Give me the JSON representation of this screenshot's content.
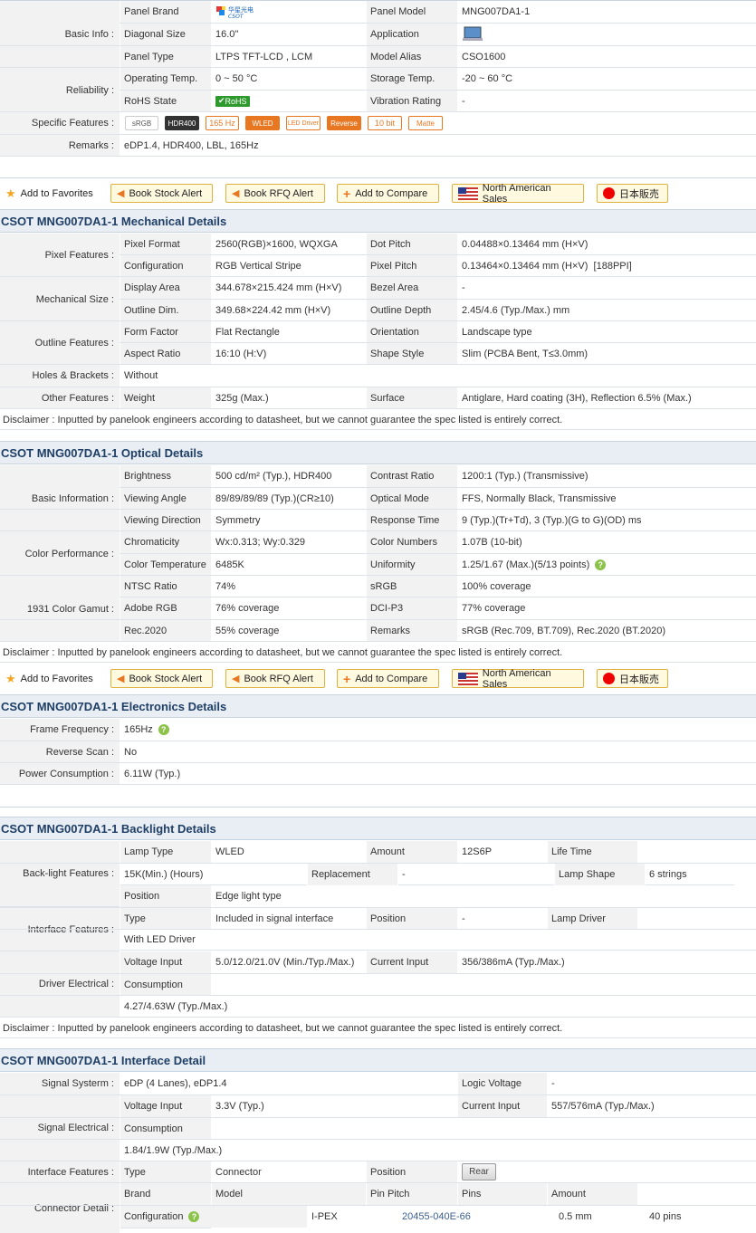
{
  "basic": {
    "label_basic": "Basic Info :",
    "label_reliability": "Reliability :",
    "panel_brand_key": "Panel Brand",
    "brand_logo_text": "CSOT",
    "panel_model_key": "Panel Model",
    "panel_model": "MNG007DA1-1",
    "diagonal_key": "Diagonal Size",
    "diagonal": "16.0\"",
    "application_key": "Application",
    "application_icon": "laptop-icon",
    "panel_type_key": "Panel Type",
    "panel_type": "LTPS TFT-LCD , LCM",
    "model_alias_key": "Model Alias",
    "model_alias": "CSO1600",
    "op_temp_key": "Operating Temp.",
    "op_temp": "0 ~ 50 °C",
    "storage_temp_key": "Storage Temp.",
    "storage_temp": "-20 ~ 60 °C",
    "rohs_key": "RoHS State",
    "rohs_badge": "RoHS",
    "vibration_key": "Vibration Rating",
    "vibration": "-",
    "specific_features_label": "Specific Features :",
    "feature_badges": [
      "sRGB",
      "HDR400",
      "165 Hz",
      "WLED",
      "LED Driver",
      "Reverse",
      "10 bit",
      "Matte"
    ],
    "remarks_label": "Remarks :",
    "remarks": "eDP1.4, HDR400, LBL, 165Hz"
  },
  "buttons": {
    "favorites": "Add to Favorites",
    "stock_alert": "Book Stock Alert",
    "rfq_alert": "Book RFQ Alert",
    "compare": "Add to Compare",
    "na_sales": "North American Sales",
    "jp_sales": "日本販売"
  },
  "mechanical": {
    "title": "CSOT MNG007DA1-1 Mechanical Details",
    "pixel_features_label": "Pixel Features :",
    "pixel_format_key": "Pixel Format",
    "pixel_format": "2560(RGB)×1600, WQXGA",
    "dot_pitch_key": "Dot Pitch",
    "dot_pitch": "0.04488×0.13464 mm (H×V)",
    "configuration_key": "Configuration",
    "configuration": "RGB Vertical Stripe",
    "pixel_pitch_key": "Pixel Pitch",
    "pixel_pitch": "0.13464×0.13464 mm (H×V)  [188PPI]",
    "mech_size_label": "Mechanical Size :",
    "display_area_key": "Display Area",
    "display_area": "344.678×215.424 mm (H×V)",
    "bezel_area_key": "Bezel Area",
    "bezel_area": "-",
    "outline_dim_key": "Outline Dim.",
    "outline_dim": "349.68×224.42 mm (H×V)",
    "outline_depth_key": "Outline Depth",
    "outline_depth": "2.45/4.6 (Typ./Max.) mm",
    "outline_features_label": "Outline Features :",
    "form_factor_key": "Form Factor",
    "form_factor": "Flat Rectangle",
    "orientation_key": "Orientation",
    "orientation": "Landscape type",
    "aspect_ratio_key": "Aspect Ratio",
    "aspect_ratio": "16:10 (H:V)",
    "shape_style_key": "Shape Style",
    "shape_style": "Slim (PCBA Bent, T≤3.0mm)",
    "holes_label": "Holes & Brackets :",
    "holes": "Without",
    "other_features_label": "Other Features :",
    "weight_key": "Weight",
    "weight": "325g (Max.)",
    "surface_key": "Surface",
    "surface": "Antiglare, Hard coating (3H), Reflection 6.5% (Max.)",
    "disclaimer": "Disclaimer : Inputted by panelook engineers according to datasheet, but we cannot guarantee the spec listed is entirely correct."
  },
  "optical": {
    "title": "CSOT MNG007DA1-1 Optical Details",
    "basic_info_label": "Basic Information :",
    "brightness_key": "Brightness",
    "brightness": "500 cd/m² (Typ.), HDR400",
    "contrast_key": "Contrast Ratio",
    "contrast": "1200:1 (Typ.) (Transmissive)",
    "viewing_angle_key": "Viewing Angle",
    "viewing_angle": "89/89/89/89 (Typ.)(CR≥10)",
    "optical_mode_key": "Optical Mode",
    "optical_mode": "FFS, Normally Black, Transmissive",
    "viewing_dir_key": "Viewing Direction",
    "viewing_dir": "Symmetry",
    "response_key": "Response Time",
    "response": "9 (Typ.)(Tr+Td), 3 (Typ.)(G to G)(OD) ms",
    "color_perf_label": "Color Performance :",
    "chromaticity_key": "Chromaticity",
    "chromaticity": "Wx:0.313; Wy:0.329",
    "color_numbers_key": "Color Numbers",
    "color_numbers": "1.07B (10-bit)",
    "color_temp_key": "Color Temperature",
    "color_temp": "6485K",
    "uniformity_key": "Uniformity",
    "uniformity": "1.25/1.67 (Max.)(5/13 points)",
    "gamut_label": "1931 Color Gamut :",
    "ntsc_key": "NTSC Ratio",
    "ntsc": "74%",
    "srgb_key": "sRGB",
    "srgb": "100% coverage",
    "adobe_key": "Adobe RGB",
    "adobe": "76% coverage",
    "dcip3_key": "DCI-P3",
    "dcip3": "77% coverage",
    "rec2020_key": "Rec.2020",
    "rec2020": "55% coverage",
    "remarks_key": "Remarks",
    "remarks": "sRGB (Rec.709, BT.709), Rec.2020 (BT.2020)",
    "disclaimer": "Disclaimer : Inputted by panelook engineers according to datasheet, but we cannot guarantee the spec listed is entirely correct."
  },
  "electronics": {
    "title": "CSOT MNG007DA1-1 Electronics Details",
    "frame_freq_label": "Frame Frequency :",
    "frame_freq": "165Hz",
    "reverse_scan_label": "Reverse Scan :",
    "reverse_scan": "No",
    "power_label": "Power Consumption :",
    "power": "6.11W (Typ.)"
  },
  "backlight": {
    "title": "CSOT MNG007DA1-1 Backlight Details",
    "features_label": "Back-light Features :",
    "lamp_type_key": "Lamp Type",
    "lamp_type": "WLED",
    "amount_key": "Amount",
    "amount": "12S6P",
    "life_time_key": "Life Time",
    "life_time": "15K(Min.) (Hours)",
    "replacement_key": "Replacement",
    "replacement": "-",
    "lamp_shape_key": "Lamp Shape",
    "lamp_shape": "6 strings",
    "position_key": "Position",
    "position": "Edge light type",
    "interface_label": "Interface Features :",
    "type_key": "Type",
    "type": "Included in signal interface",
    "position2_key": "Position",
    "position2": "-",
    "lamp_driver_key": "Lamp Driver",
    "lamp_driver": "With LED Driver",
    "driver_label": "Driver Electrical :",
    "voltage_key": "Voltage Input",
    "voltage": "5.0/12.0/21.0V (Min./Typ./Max.)",
    "current_key": "Current Input",
    "current": "356/386mA (Typ./Max.)",
    "consumption_key": "Consumption",
    "consumption": "4.27/4.63W (Typ./Max.)",
    "disclaimer": "Disclaimer : Inputted by panelook engineers according to datasheet, but we cannot guarantee the spec listed is entirely correct."
  },
  "interface": {
    "title": "CSOT MNG007DA1-1 Interface Detail",
    "signal_system_label": "Signal Systerm :",
    "signal_system": "eDP (4 Lanes), eDP1.4",
    "logic_voltage_key": "Logic Voltage",
    "logic_voltage": "-",
    "signal_electrical_label": "Signal Electrical :",
    "voltage_key": "Voltage Input",
    "voltage": "3.3V (Typ.)",
    "current_key": "Current Input",
    "current": "557/576mA (Typ./Max.)",
    "consumption_key": "Consumption",
    "consumption": "1.84/1.9W (Typ./Max.)",
    "interface_features_label": "Interface Features :",
    "type_key": "Type",
    "type": "Connector",
    "position_key": "Position",
    "position_button": "Rear",
    "connector_label": "Connector Detail :",
    "brand_key": "Brand",
    "model_key": "Model",
    "pin_pitch_key": "Pin Pitch",
    "pins_key": "Pins",
    "amount_key": "Amount",
    "configuration_key": "Configuration",
    "brand": "I-PEX",
    "model": "20455-040E-66",
    "pin_pitch": "0.5 mm",
    "pins": "40 pins"
  }
}
